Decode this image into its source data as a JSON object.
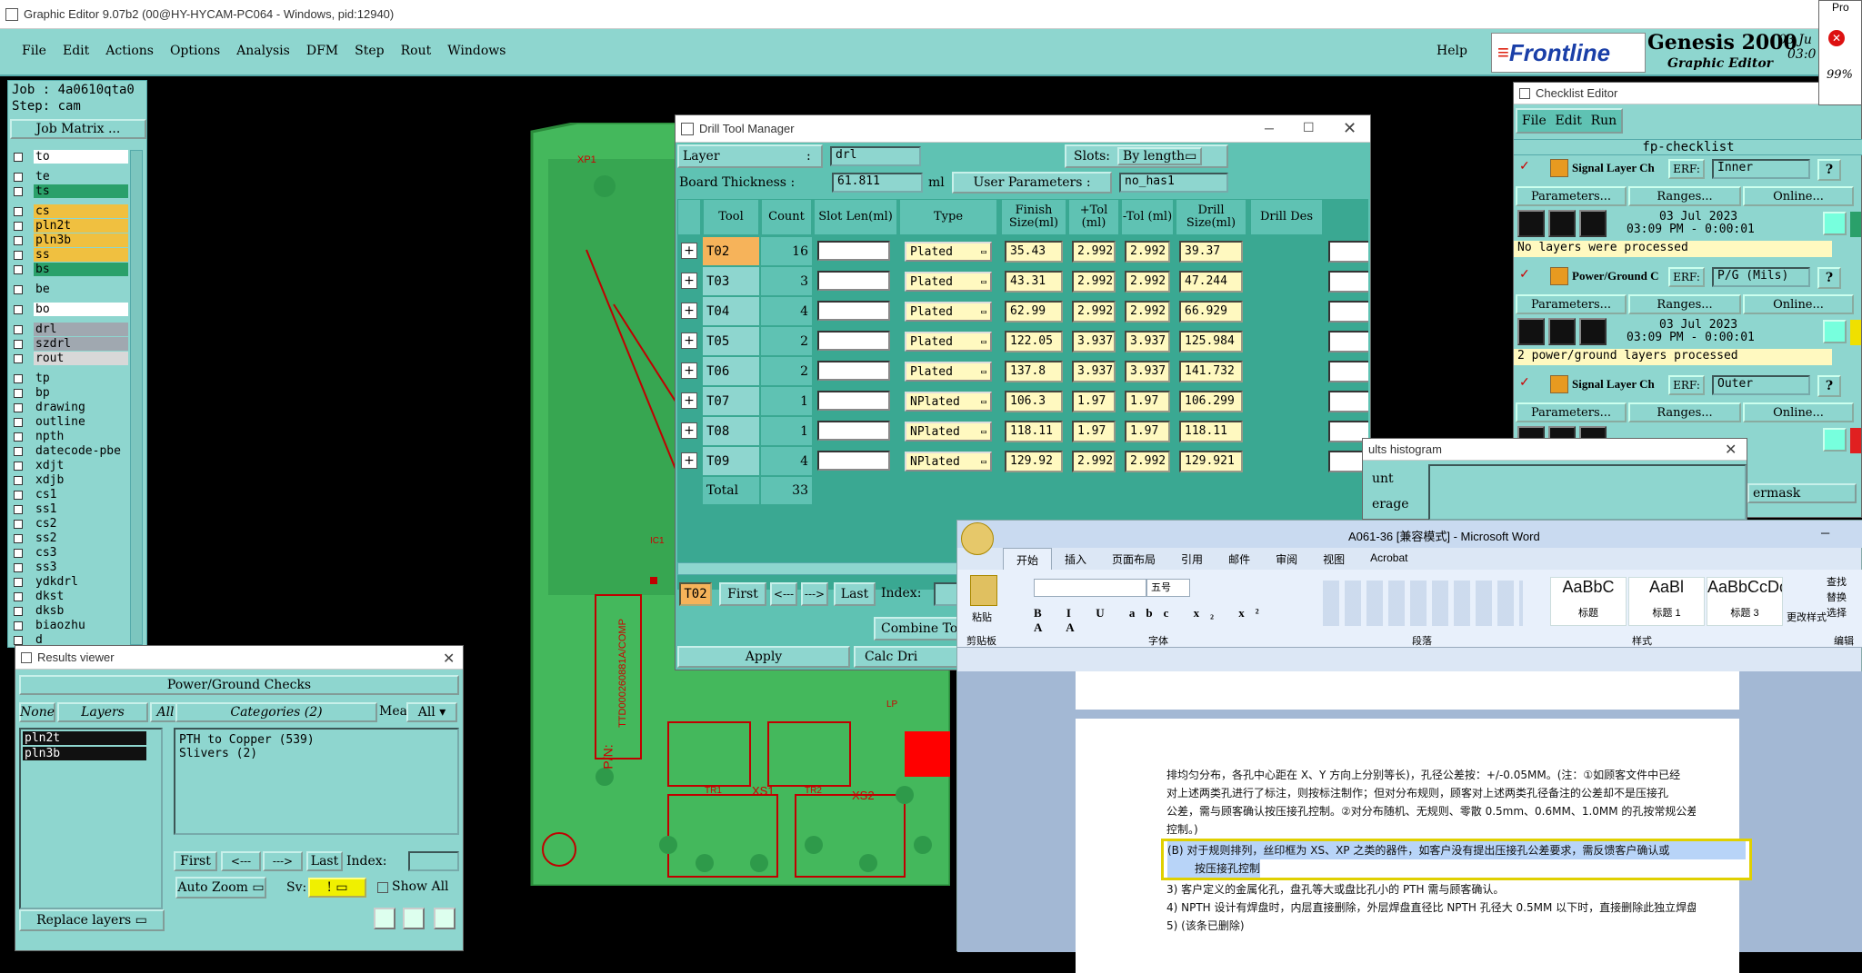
{
  "main_window": {
    "title": "Graphic Editor 9.07b2 (00@HY-HYCAM-PC064 - Windows, pid:12940)",
    "menu": [
      "File",
      "Edit",
      "Actions",
      "Options",
      "Analysis",
      "DFM",
      "Step",
      "Rout",
      "Windows"
    ],
    "help": "Help",
    "brand": "Frontline",
    "product": "Genesis 2000",
    "subtitle": "Graphic Editor",
    "date": "03 Ju",
    "time": "03:0"
  },
  "left_panel": {
    "job": "Job : 4a0610qta0",
    "step": "Step: cam",
    "job_matrix": "Job Matrix ...",
    "layers": [
      {
        "name": "to",
        "color": "#ffffff"
      },
      {
        "name": "te",
        "color": "#8ed6cf"
      },
      {
        "name": "ts",
        "color": "#2aa06a"
      },
      {
        "name": "cs",
        "color": "#f0c040"
      },
      {
        "name": "pln2t",
        "color": "#f0c040"
      },
      {
        "name": "pln3b",
        "color": "#f0c040"
      },
      {
        "name": "ss",
        "color": "#f0c040"
      },
      {
        "name": "bs",
        "color": "#2aa06a"
      },
      {
        "name": "be",
        "color": "#8ed6cf"
      },
      {
        "name": "bo",
        "color": "#ffffff"
      },
      {
        "name": "drl",
        "color": "#a0a8b0"
      },
      {
        "name": "szdrl",
        "color": "#a0a8b0"
      },
      {
        "name": "rout",
        "color": "#d8d8d8"
      },
      {
        "name": "tp",
        "color": "#8ed6cf"
      },
      {
        "name": "bp",
        "color": "#8ed6cf"
      },
      {
        "name": "drawing",
        "color": "#8ed6cf"
      },
      {
        "name": "outline",
        "color": "#8ed6cf"
      },
      {
        "name": "npth",
        "color": "#8ed6cf"
      },
      {
        "name": "datecode-pbe",
        "color": "#8ed6cf"
      },
      {
        "name": "xdjt",
        "color": "#8ed6cf"
      },
      {
        "name": "xdjb",
        "color": "#8ed6cf"
      },
      {
        "name": "cs1",
        "color": "#8ed6cf"
      },
      {
        "name": "ss1",
        "color": "#8ed6cf"
      },
      {
        "name": "cs2",
        "color": "#8ed6cf"
      },
      {
        "name": "ss2",
        "color": "#8ed6cf"
      },
      {
        "name": "cs3",
        "color": "#8ed6cf"
      },
      {
        "name": "ss3",
        "color": "#8ed6cf"
      },
      {
        "name": "ydkdrl",
        "color": "#8ed6cf"
      },
      {
        "name": "dkst",
        "color": "#8ed6cf"
      },
      {
        "name": "dksb",
        "color": "#8ed6cf"
      },
      {
        "name": "biaozhu",
        "color": "#8ed6cf"
      },
      {
        "name": "d",
        "color": "#8ed6cf"
      }
    ]
  },
  "pcb": {
    "labels": [
      "XP1",
      "TTD000260881A/COMP",
      "P/N:",
      "XS1",
      "XS2",
      "TR1",
      "TR2",
      "LP",
      "IC1"
    ]
  },
  "drill_tool_manager": {
    "title": "Drill Tool Manager",
    "layer_label": "Layer",
    "layer_value": "drl",
    "slots_label": "Slots:",
    "slots_value": "By length",
    "board_thickness_label": "Board Thickness :",
    "board_thickness_value": "61.811",
    "board_thickness_unit": "ml",
    "user_params_label": "User Parameters :",
    "user_params_value": "no_has1",
    "headers": [
      "Tool",
      "Count",
      "Slot Len(ml)",
      "Type",
      "Finish Size(ml)",
      "+Tol (ml)",
      "-Tol (ml)",
      "Drill Size(ml)",
      "Drill Des"
    ],
    "rows": [
      {
        "tool": "T02",
        "count": "16",
        "type": "Plated",
        "finish": "35.43",
        "ptol": "2.992",
        "mtol": "2.992",
        "drill": "39.37"
      },
      {
        "tool": "T03",
        "count": "3",
        "type": "Plated",
        "finish": "43.31",
        "ptol": "2.992",
        "mtol": "2.992",
        "drill": "47.244"
      },
      {
        "tool": "T04",
        "count": "4",
        "type": "Plated",
        "finish": "62.99",
        "ptol": "2.992",
        "mtol": "2.992",
        "drill": "66.929"
      },
      {
        "tool": "T05",
        "count": "2",
        "type": "Plated",
        "finish": "122.05",
        "ptol": "3.937",
        "mtol": "3.937",
        "drill": "125.984"
      },
      {
        "tool": "T06",
        "count": "2",
        "type": "Plated",
        "finish": "137.8",
        "ptol": "3.937",
        "mtol": "3.937",
        "drill": "141.732"
      },
      {
        "tool": "T07",
        "count": "1",
        "type": "NPlated",
        "finish": "106.3",
        "ptol": "1.97",
        "mtol": "1.97",
        "drill": "106.299"
      },
      {
        "tool": "T08",
        "count": "1",
        "type": "NPlated",
        "finish": "118.11",
        "ptol": "1.97",
        "mtol": "1.97",
        "drill": "118.11"
      },
      {
        "tool": "T09",
        "count": "4",
        "type": "NPlated",
        "finish": "129.92",
        "ptol": "2.992",
        "mtol": "2.992",
        "drill": "129.921"
      }
    ],
    "total_label": "Total",
    "total_count": "33",
    "current_tool": "T02",
    "first": "First",
    "prev": "<---",
    "next": "--->",
    "last": "Last",
    "index_label": "Index:",
    "combine": "Combine To",
    "apply": "Apply",
    "calc": "Calc Dri"
  },
  "checklist": {
    "title": "Checklist Editor",
    "menu": [
      "File",
      "Edit",
      "Run"
    ],
    "name": "fp-checklist",
    "items": [
      {
        "name": "Signal Layer Ch",
        "erf": "ERF:",
        "erf_value": "Inner",
        "params": "Parameters...",
        "ranges": "Ranges...",
        "online": "Online...",
        "date": "03 Jul 2023",
        "time": "03:09 PM - 0:00:01",
        "status": "No layers were processed",
        "ind": "#2aa06a"
      },
      {
        "name": "Power/Ground C",
        "erf": "ERF:",
        "erf_value": "P/G (Mils)",
        "params": "Parameters...",
        "ranges": "Ranges...",
        "online": "Online...",
        "date": "03 Jul 2023",
        "time": "03:09 PM - 0:00:01",
        "status": "2 power/ground layers processed",
        "ind": "#f0e000"
      },
      {
        "name": "Signal Layer Ch",
        "erf": "ERF:",
        "erf_value": "Outer",
        "params": "Parameters...",
        "ranges": "Ranges...",
        "online": "Online...",
        "ind": "#e02020"
      }
    ]
  },
  "progress": {
    "title": "Pro",
    "percent": "99%"
  },
  "histogram": {
    "title": "ults histogram",
    "labels": [
      "unt",
      "erage"
    ],
    "mask": "ermask"
  },
  "results_viewer": {
    "title": "Results viewer",
    "header": "Power/Ground Checks",
    "none": "None",
    "layers": "Layers",
    "all": "All",
    "categories": "Categories (2)",
    "meas_label": "Meas:",
    "meas_value": "All",
    "layer_items": [
      "pln2t",
      "pln3b"
    ],
    "category_items": [
      "PTH to Copper (539)",
      "Slivers (2)"
    ],
    "first": "First",
    "prev": "<---",
    "next": "--->",
    "last": "Last",
    "index_label": "Index:",
    "auto_zoom": "Auto Zoom",
    "sv_label": "Sv:",
    "sv_value": "!",
    "show_all": "Show All",
    "replace": "Replace layers"
  },
  "word": {
    "title": "A061-36 [兼容模式] - Microsoft Word",
    "tabs": [
      "开始",
      "插入",
      "页面布局",
      "引用",
      "邮件",
      "审阅",
      "视图",
      "Acrobat"
    ],
    "paste": "粘贴",
    "clipboard": "剪贴板",
    "font_size": "五号",
    "font_group": "字体",
    "para_group": "段落",
    "style_group": "样式",
    "edit_group": "编辑",
    "change_style": "更改样式",
    "styles": [
      {
        "sample": "AaBbC",
        "name": "标题"
      },
      {
        "sample": "AaBl",
        "name": "标题 1"
      },
      {
        "sample": "AaBbCcDc",
        "name": "标题 3"
      }
    ],
    "edit_items": [
      "查找",
      "替换",
      "选择"
    ],
    "lines": [
      "排均匀分布，各孔中心距在 X、Y 方向上分别等长)，孔径公差按：+/-0.05MM。(注：①如顾客文件中已经",
      "对上述两类孔进行了标注，则按标注制作；但对分布规则，顾客对上述两类孔径备注的公差却不是压接孔",
      "公差，需与顾客确认按压接孔控制。②对分布随机、无规则、零散 0.5mm、0.6MM、1.0MM 的孔按常规公差",
      "控制。)"
    ],
    "highlight_lines": [
      "(B) 对于规则排列，丝印框为 XS、XP 之类的器件，如客户没有提出压接孔公差要求，需反馈客户确认或",
      "按压接孔控制"
    ],
    "after_lines": [
      "3) 客户定义的金属化孔，盘孔等大或盘比孔小的 PTH 需与顾客确认。",
      "4) NPTH 设计有焊盘时，内层直接删除，外层焊盘直径比 NPTH 孔径大 0.5MM 以下时，直接删除此独立焊盘；",
      "5) (该条已删除)"
    ]
  }
}
